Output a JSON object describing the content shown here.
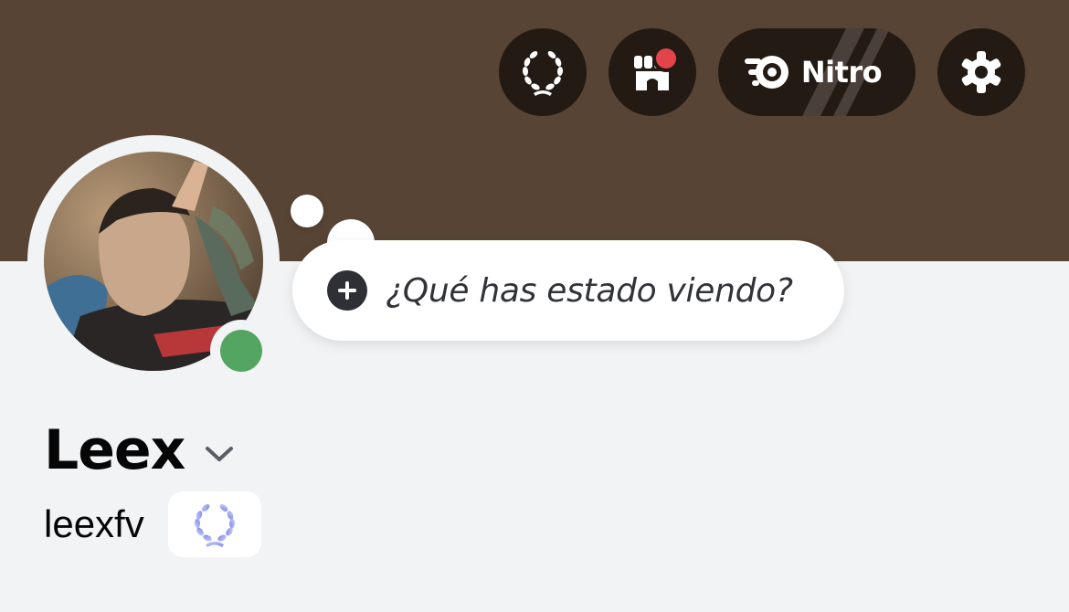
{
  "header": {
    "quests_button": {
      "icon": "laurel-wreath-icon"
    },
    "shop_button": {
      "icon": "shop-icon",
      "has_notification": true
    },
    "nitro_button": {
      "icon": "nitro-icon",
      "label": "Nitro"
    },
    "settings_button": {
      "icon": "gear-icon"
    }
  },
  "profile": {
    "avatar": "avatar",
    "status": "online",
    "display_name": "Leex",
    "username": "leexfv",
    "badge_icon": "laurel-wreath-badge-icon"
  },
  "status_bubble": {
    "icon": "plus-icon",
    "text": "¿Qué has estado viendo?"
  },
  "colors": {
    "banner": "#574434",
    "button_bg": "#231a13",
    "page_bg": "#f2f3f5",
    "online": "#54a562",
    "notification": "#e2444a",
    "badge_accent": "#8c97f0"
  }
}
